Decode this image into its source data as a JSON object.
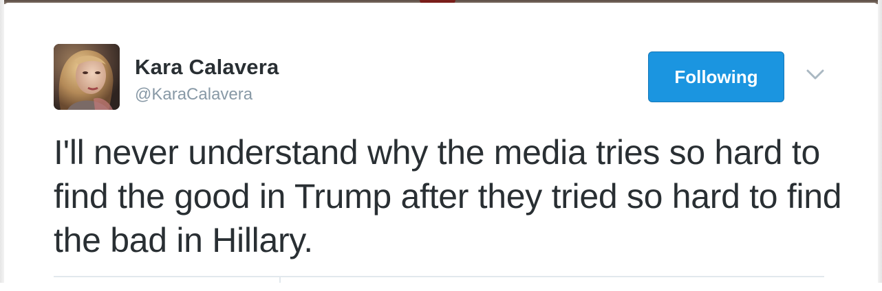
{
  "user": {
    "display_name": "Kara Calavera",
    "handle": "@KaraCalavera"
  },
  "follow_button": {
    "label": "Following"
  },
  "menu": {
    "icon": "chevron-down-icon"
  },
  "tweet": {
    "text": "I'll never understand why the media tries so hard to find the good in Trump after they tried so hard to find the bad in Hillary."
  },
  "colors": {
    "accent": "#1b95e0",
    "text": "#292f33",
    "muted": "#8899a6",
    "divider": "#e1e8ed"
  }
}
